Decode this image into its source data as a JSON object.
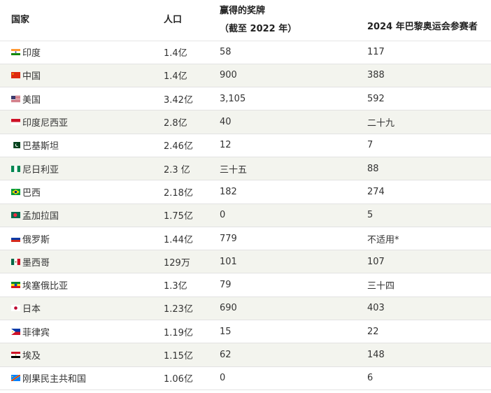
{
  "headers": {
    "country": "国家",
    "population": "人口",
    "medals_line1": "赢得的奖牌",
    "medals_line2": "（截至 2022 年）",
    "paris": "2024 年巴黎奥运会参赛者"
  },
  "rows": [
    {
      "flag": "india-flag-icon",
      "name": "印度",
      "population": "1.4亿",
      "medals": "58",
      "paris": "117"
    },
    {
      "flag": "china-flag-icon",
      "name": "中国",
      "population": "1.4亿",
      "medals": "900",
      "paris": "388"
    },
    {
      "flag": "usa-flag-icon",
      "name": "美国",
      "population": "3.42亿",
      "medals": "3,105",
      "paris": "592"
    },
    {
      "flag": "indonesia-flag-icon",
      "name": "印度尼西亚",
      "population": "2.8亿",
      "medals": "40",
      "paris": "二十九"
    },
    {
      "flag": "pakistan-flag-icon",
      "name": "巴基斯坦",
      "population": "2.46亿",
      "medals": "12",
      "paris": "7"
    },
    {
      "flag": "nigeria-flag-icon",
      "name": "尼日利亚",
      "population": "2.3 亿",
      "medals": "三十五",
      "paris": "88"
    },
    {
      "flag": "brazil-flag-icon",
      "name": "巴西",
      "population": "2.18亿",
      "medals": "182",
      "paris": "274"
    },
    {
      "flag": "bangladesh-flag-icon",
      "name": "孟加拉国",
      "population": "1.75亿",
      "medals": "0",
      "paris": "5"
    },
    {
      "flag": "russia-flag-icon",
      "name": "俄罗斯",
      "population": "1.44亿",
      "medals": "779",
      "paris": "不适用*"
    },
    {
      "flag": "mexico-flag-icon",
      "name": "墨西哥",
      "population": "129万",
      "medals": "101",
      "paris": "107"
    },
    {
      "flag": "ethiopia-flag-icon",
      "name": "埃塞俄比亚",
      "population": "1.3亿",
      "medals": "79",
      "paris": "三十四"
    },
    {
      "flag": "japan-flag-icon",
      "name": "日本",
      "population": "1.23亿",
      "medals": "690",
      "paris": "403"
    },
    {
      "flag": "philippines-flag-icon",
      "name": "菲律宾",
      "population": "1.19亿",
      "medals": "15",
      "paris": "22"
    },
    {
      "flag": "egypt-flag-icon",
      "name": "埃及",
      "population": "1.15亿",
      "medals": "62",
      "paris": "148"
    },
    {
      "flag": "drc-flag-icon",
      "name": "刚果民主共和国",
      "population": "1.06亿",
      "medals": "0",
      "paris": "6"
    }
  ],
  "colors": {
    "row_alt": "#f3f4ee",
    "row_plain": "#ffffff",
    "border": "#e2e2e2",
    "text": "#333333"
  }
}
